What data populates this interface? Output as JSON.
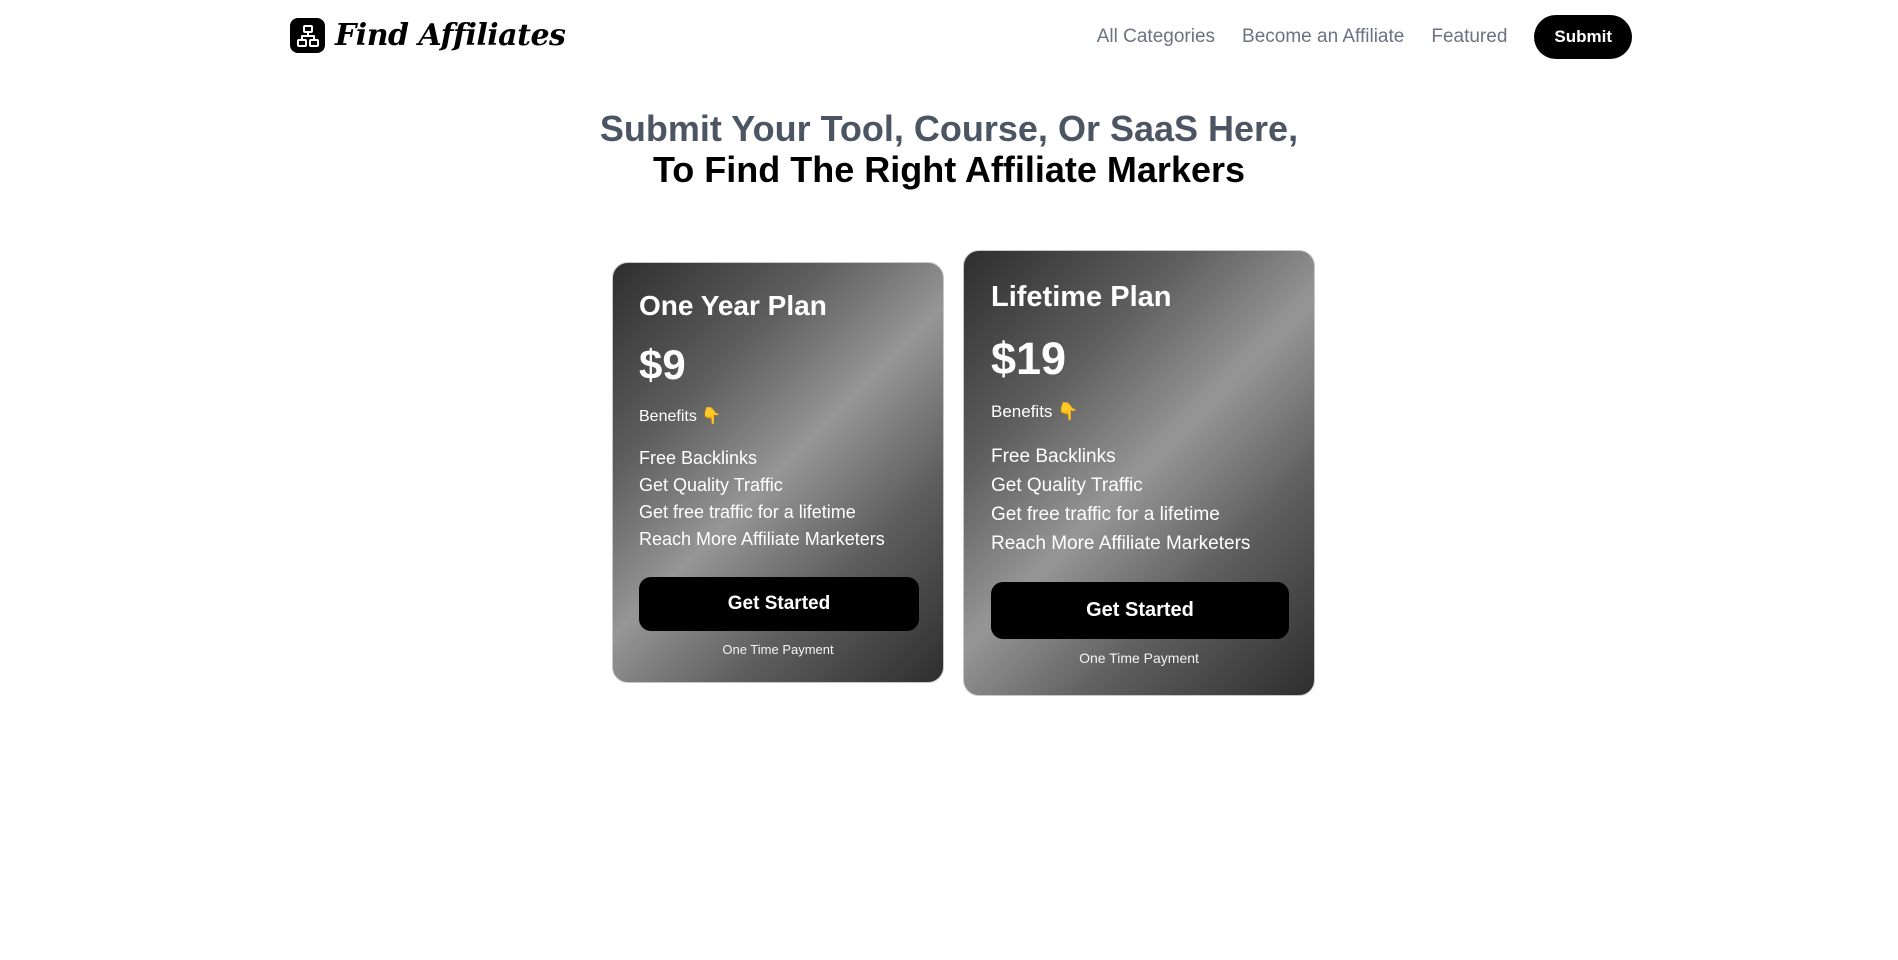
{
  "header": {
    "logo_text": "Find Affiliates",
    "logo_icon": "sitemap-icon",
    "nav": [
      {
        "label": "All Categories"
      },
      {
        "label": "Become an Affiliate"
      },
      {
        "label": "Featured"
      }
    ],
    "submit_label": "Submit"
  },
  "hero": {
    "line1": "Submit Your Tool, Course, Or SaaS Here,",
    "line2": "To Find The Right Affiliate Markers"
  },
  "plans": [
    {
      "title": "One Year Plan",
      "price": "$9",
      "benefits_label": "Benefits",
      "benefits_icon": "👇",
      "features": [
        "Free Backlinks",
        "Get Quality Traffic",
        "Get free traffic for a lifetime",
        "Reach More Affiliate Marketers"
      ],
      "cta": "Get Started",
      "note": "One Time Payment"
    },
    {
      "title": "Lifetime Plan",
      "price": "$19",
      "benefits_label": "Benefits",
      "benefits_icon": "👇",
      "features": [
        "Free Backlinks",
        "Get Quality Traffic",
        "Get free traffic for a lifetime",
        "Reach More Affiliate Marketers"
      ],
      "cta": "Get Started",
      "note": "One Time Payment"
    }
  ],
  "colors": {
    "primary": "#000000",
    "nav_text": "#6b7280",
    "headline_muted": "#4b5563",
    "card_gradient_dark": "#2e2e2e",
    "card_gradient_light": "#969696"
  }
}
